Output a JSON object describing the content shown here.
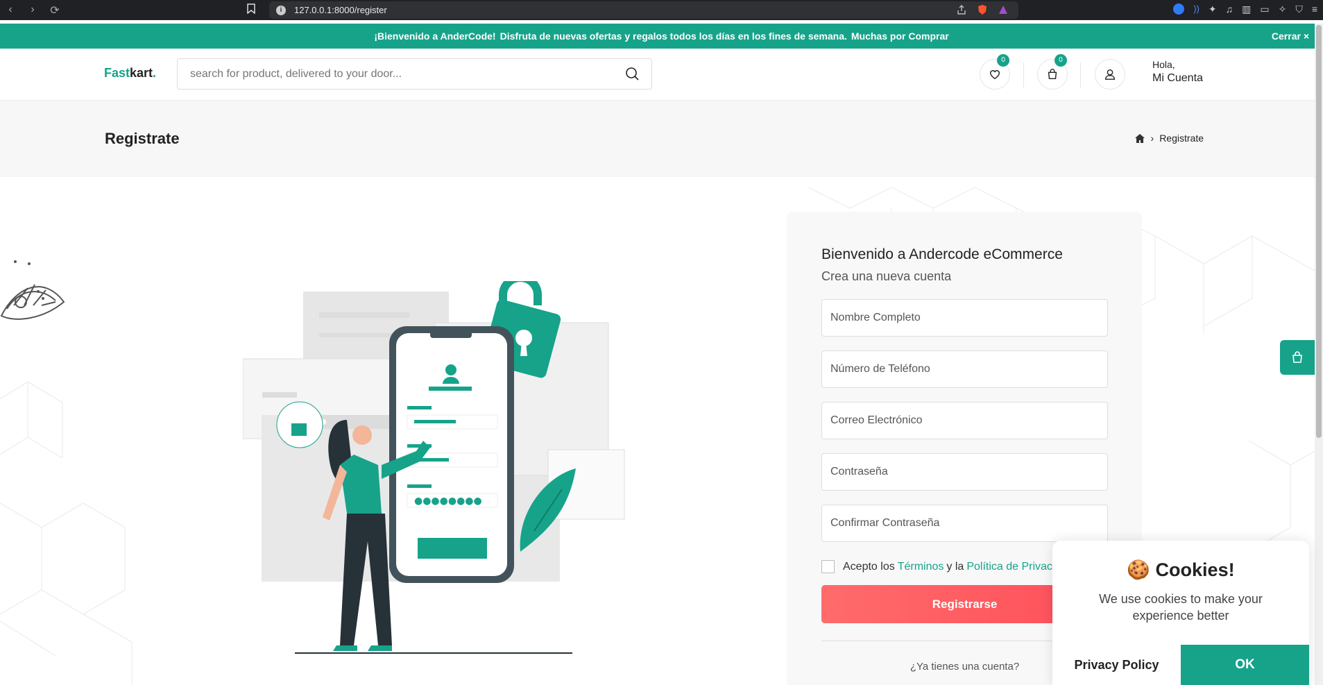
{
  "browser": {
    "url": "127.0.0.1:8000/register"
  },
  "promo": {
    "welcome": "¡Bienvenido a AnderCode!",
    "message": "Disfruta de nuevas ofertas y regalos todos los días en los fines de semana.",
    "thanks": "Muchas por Comprar",
    "close_label": "Cerrar ×"
  },
  "header": {
    "logo_accent": "Fast",
    "logo_rest": "kart",
    "logo_dot": ".",
    "search_placeholder": "search for product, delivered to your door...",
    "wishlist_count": "0",
    "cart_count": "0",
    "greeting": "Hola,",
    "account_label": "Mi Cuenta"
  },
  "breadcrumb": {
    "title": "Registrate",
    "current": "Registrate"
  },
  "form": {
    "heading": "Bienvenido a Andercode eCommerce",
    "subheading": "Crea una nueva cuenta",
    "fields": {
      "name": "Nombre Completo",
      "phone": "Número de Teléfono",
      "email": "Correo Electrónico",
      "password": "Contraseña",
      "confirm": "Confirmar Contraseña"
    },
    "terms_prefix": "Acepto los",
    "terms_link": "Términos",
    "terms_mid": "y la",
    "privacy_link": "Política de Privacidad",
    "submit": "Registrarse",
    "have_account": "¿Ya tienes una cuenta?"
  },
  "cookie": {
    "emoji": "🍪",
    "title": "Cookies!",
    "text": "We use cookies to make your experience better",
    "privacy": "Privacy Policy",
    "ok": "OK"
  },
  "colors": {
    "brand": "#16a38a",
    "register_button": "#ff5a5f"
  }
}
